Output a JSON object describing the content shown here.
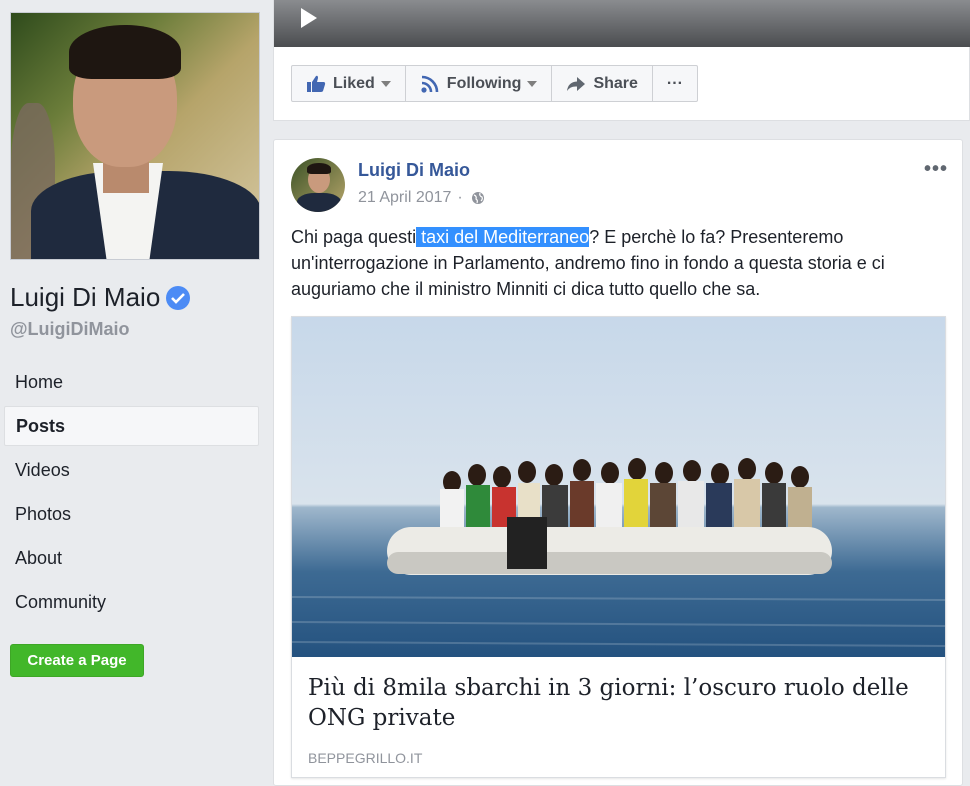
{
  "sidebar": {
    "page_name": "Luigi Di Maio",
    "handle": "@LuigiDiMaio",
    "nav_items": [
      {
        "label": "Home",
        "active": false
      },
      {
        "label": "Posts",
        "active": true
      },
      {
        "label": "Videos",
        "active": false
      },
      {
        "label": "Photos",
        "active": false
      },
      {
        "label": "About",
        "active": false
      },
      {
        "label": "Community",
        "active": false
      }
    ],
    "create_page_label": "Create a Page"
  },
  "top_actions": {
    "liked_label": "Liked",
    "following_label": "Following",
    "share_label": "Share",
    "more_label": "···"
  },
  "post": {
    "author": "Luigi Di Maio",
    "date": "21 April 2017",
    "separator": "·",
    "more_label": "•••",
    "text_before": "Chi paga questi",
    "text_highlight": " taxi del Mediterraneo",
    "text_after": "? E perchè lo fa? Presenteremo un'interrogazione in Parlamento, andremo fino in fondo a questa storia e ci auguriamo che il ministro Minniti ci dica tutto quello che sa.",
    "link": {
      "title": "Più di 8mila sbarchi in 3 giorni: l’oscuro ruolo delle ONG private",
      "domain": "BEPPEGRILLO.IT"
    }
  },
  "colors": {
    "link_blue": "#365899",
    "create_green": "#42b72a",
    "highlight": "#3390ff",
    "verified": "#4c8bf5"
  }
}
